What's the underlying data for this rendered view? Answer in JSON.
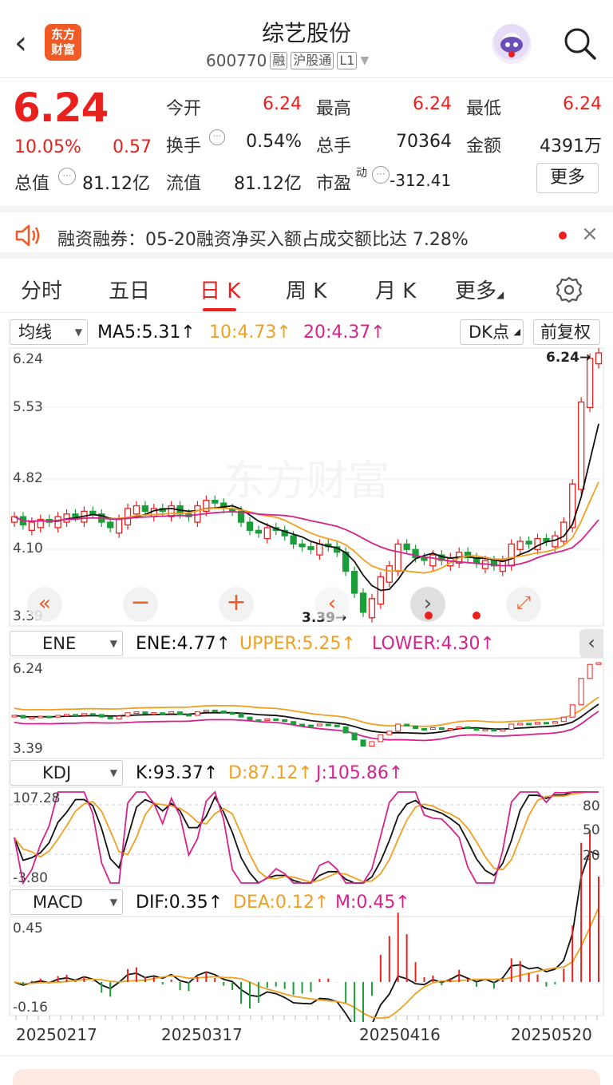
{
  "header": {
    "title": "综艺股份",
    "code": "600770",
    "tags": [
      "融",
      "沪股通",
      "L1"
    ],
    "logo_line1": "东方",
    "logo_line2": "财富",
    "back_icon": "chevron-left-icon",
    "search_icon": "search-icon"
  },
  "quote": {
    "price": "6.24",
    "change_pct": "10.05%",
    "change": "0.57",
    "open_label": "今开",
    "open": "6.24",
    "high_label": "最高",
    "high": "6.24",
    "low_label": "最低",
    "low": "6.24",
    "turnover_label": "换手",
    "turnover": "0.54%",
    "volume_label": "总手",
    "volume": "70364",
    "amount_label": "金额",
    "amount": "4391万",
    "mktcap_label": "总值",
    "mktcap": "81.12亿",
    "float_label": "流值",
    "float": "81.12亿",
    "pe_label": "市盈",
    "pe_sup": "动",
    "pe": "-312.41",
    "more_label": "更多"
  },
  "notice": {
    "text": "融资融券：05-20融资净买入额占成交额比达 7.28%"
  },
  "tabs": [
    "分时",
    "五日",
    "日 K",
    "周 K",
    "月 K",
    "更多"
  ],
  "active_tab": "日 K",
  "kline": {
    "ma_selector": "均线",
    "ma5": "MA5:5.31↑",
    "ma10": "10:4.73↑",
    "ma20": "20:4.37↑",
    "dk_label": "DK点",
    "fq_label": "前复权",
    "y_labels": [
      "6.24",
      "5.53",
      "4.82",
      "4.10",
      "3.39"
    ],
    "max_label": "6.24→",
    "min_label": "3.39→",
    "watermark": "东方财富"
  },
  "ene": {
    "selector": "ENE",
    "ene": "ENE:4.77↑",
    "upper": "UPPER:5.25↑",
    "lower": "LOWER:4.30↑",
    "y_top": "6.24",
    "y_bottom": "3.39"
  },
  "kdj": {
    "selector": "KDJ",
    "k": "K:93.37↑",
    "d": "D:87.12↑",
    "j": "J:105.86↑",
    "y_top": "107.28",
    "y_bottom": "-3.80",
    "levels": [
      "80",
      "50",
      "20"
    ]
  },
  "macd": {
    "selector": "MACD",
    "dif": "DIF:0.35↑",
    "dea": "DEA:0.12↑",
    "m": "M:0.45↑",
    "y_top": "0.45",
    "y_bottom": "-0.16"
  },
  "dates": [
    "20250217",
    "20250317",
    "20250416",
    "20250520"
  ],
  "colors": {
    "up": "#e8211e",
    "down": "#1b9e3a",
    "ma5": "#111111",
    "ma10": "#f0a020",
    "ma20": "#d6228c"
  }
}
